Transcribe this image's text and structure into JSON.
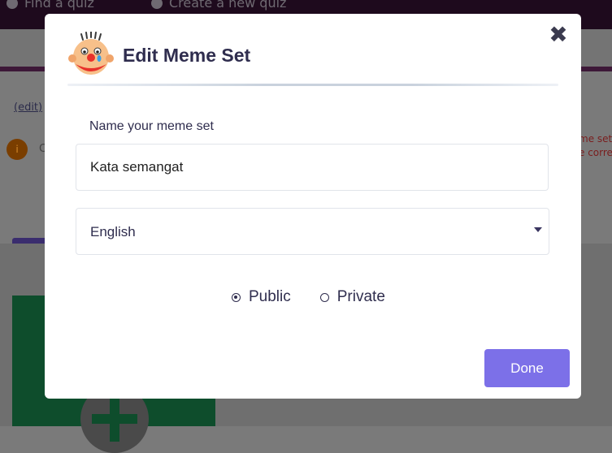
{
  "background": {
    "nav": [
      "Find a quiz",
      "Create a new quiz"
    ],
    "edit_link": "(edit)",
    "circle_letter": "i",
    "circle_text": "C",
    "side_text": [
      "me set",
      "e corre"
    ]
  },
  "modal": {
    "title": "Edit Meme Set",
    "close_glyph": "✖",
    "name_label": "Name your meme set",
    "name_value": "Kata semangat",
    "language": "English",
    "visibility": {
      "options": [
        "Public",
        "Private"
      ],
      "selected": "Public"
    },
    "done_label": "Done"
  },
  "colors": {
    "accent": "#7c70e8",
    "text": "#2f2d4e"
  }
}
